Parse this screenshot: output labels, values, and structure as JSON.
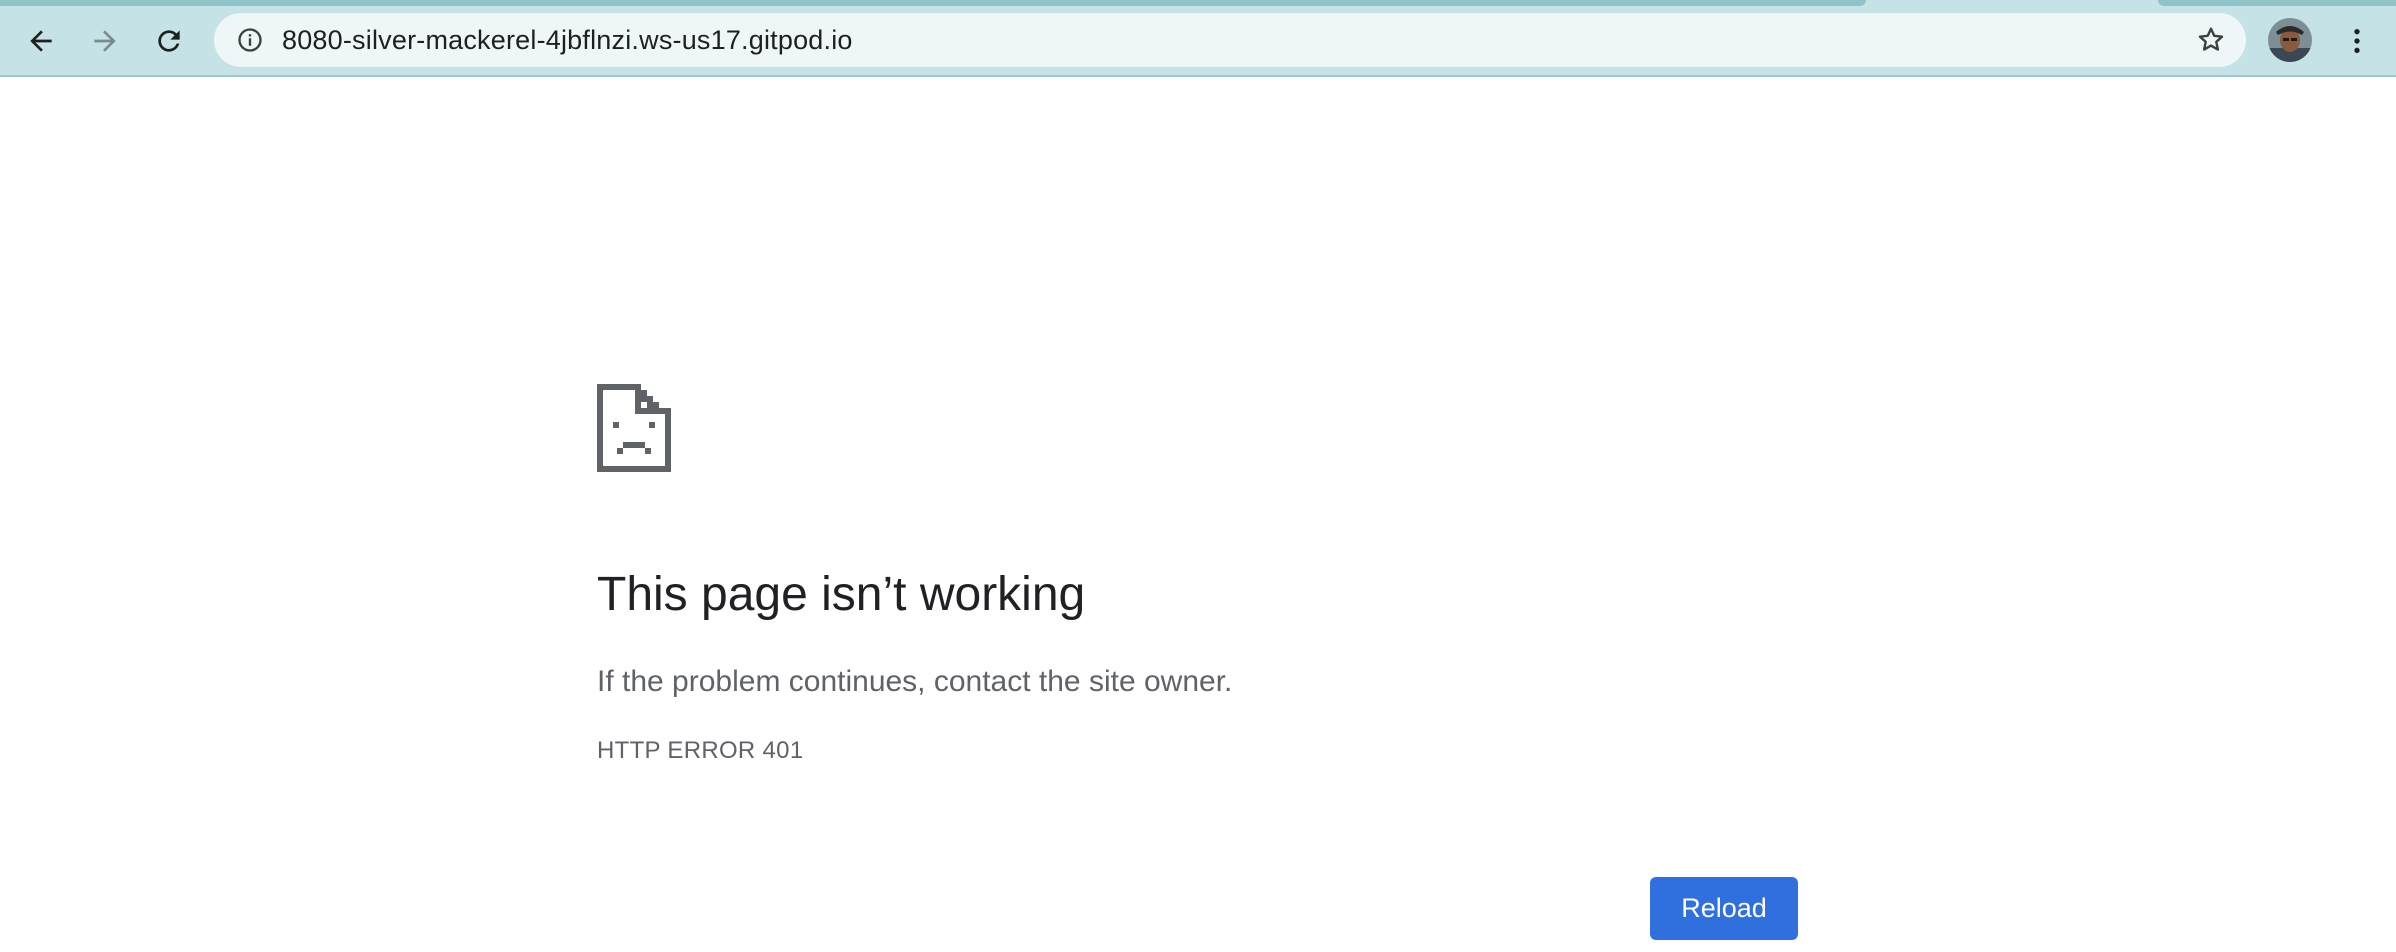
{
  "browser": {
    "url": "8080-silver-mackerel-4jbflnzi.ws-us17.gitpod.io",
    "icons": {
      "back": "arrow-left-icon",
      "forward": "arrow-right-icon",
      "reload": "refresh-icon",
      "site_info": "info-icon",
      "bookmark": "star-icon",
      "menu": "vertical-dots-icon"
    },
    "colors": {
      "toolbar": "#c5e2e6",
      "omnibox": "#eef6f7"
    }
  },
  "error_page": {
    "icon": "sad-page-icon",
    "title": "This page isn’t working",
    "description": "If the problem continues, contact the site owner.",
    "code": "HTTP ERROR 401",
    "reload_label": "Reload",
    "colors": {
      "button": "#2f6fde",
      "title": "#202124",
      "text": "#5f6368"
    }
  }
}
